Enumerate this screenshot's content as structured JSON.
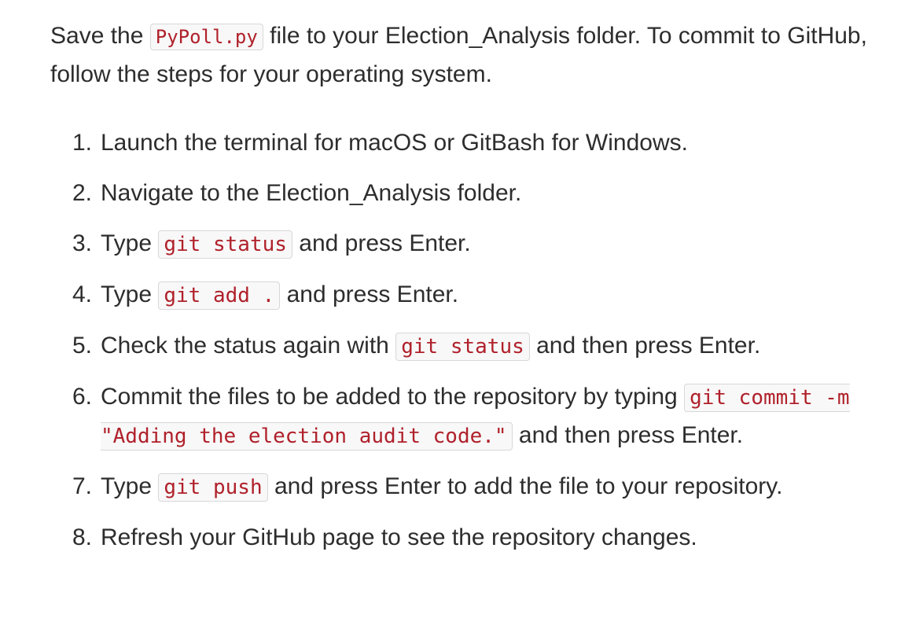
{
  "intro": {
    "before_code": "Save the ",
    "code": "PyPoll.py",
    "after_code": " file to your Election_Analysis folder. To commit to GitHub, follow the steps for your operating system."
  },
  "steps": [
    {
      "num": "1.",
      "text": "Launch the terminal for macOS or GitBash for Windows."
    },
    {
      "num": "2.",
      "text": "Navigate to the Election_Analysis folder."
    },
    {
      "num": "3.",
      "before": "Type ",
      "code": "git status",
      "after": " and press Enter."
    },
    {
      "num": "4.",
      "before": "Type ",
      "code": "git add .",
      "after": " and press Enter."
    },
    {
      "num": "5.",
      "before": "Check the status again with ",
      "code": "git status",
      "after": " and then press Enter."
    },
    {
      "num": "6.",
      "before": "Commit the files to be added to the repository by typing ",
      "code": "git commit -m \"Adding the election audit code.\"",
      "after": " and then press Enter."
    },
    {
      "num": "7.",
      "before": "Type ",
      "code": "git push",
      "after": " and press Enter to add the file to your repository."
    },
    {
      "num": "8.",
      "text": "Refresh your GitHub page to see the repository changes."
    }
  ]
}
